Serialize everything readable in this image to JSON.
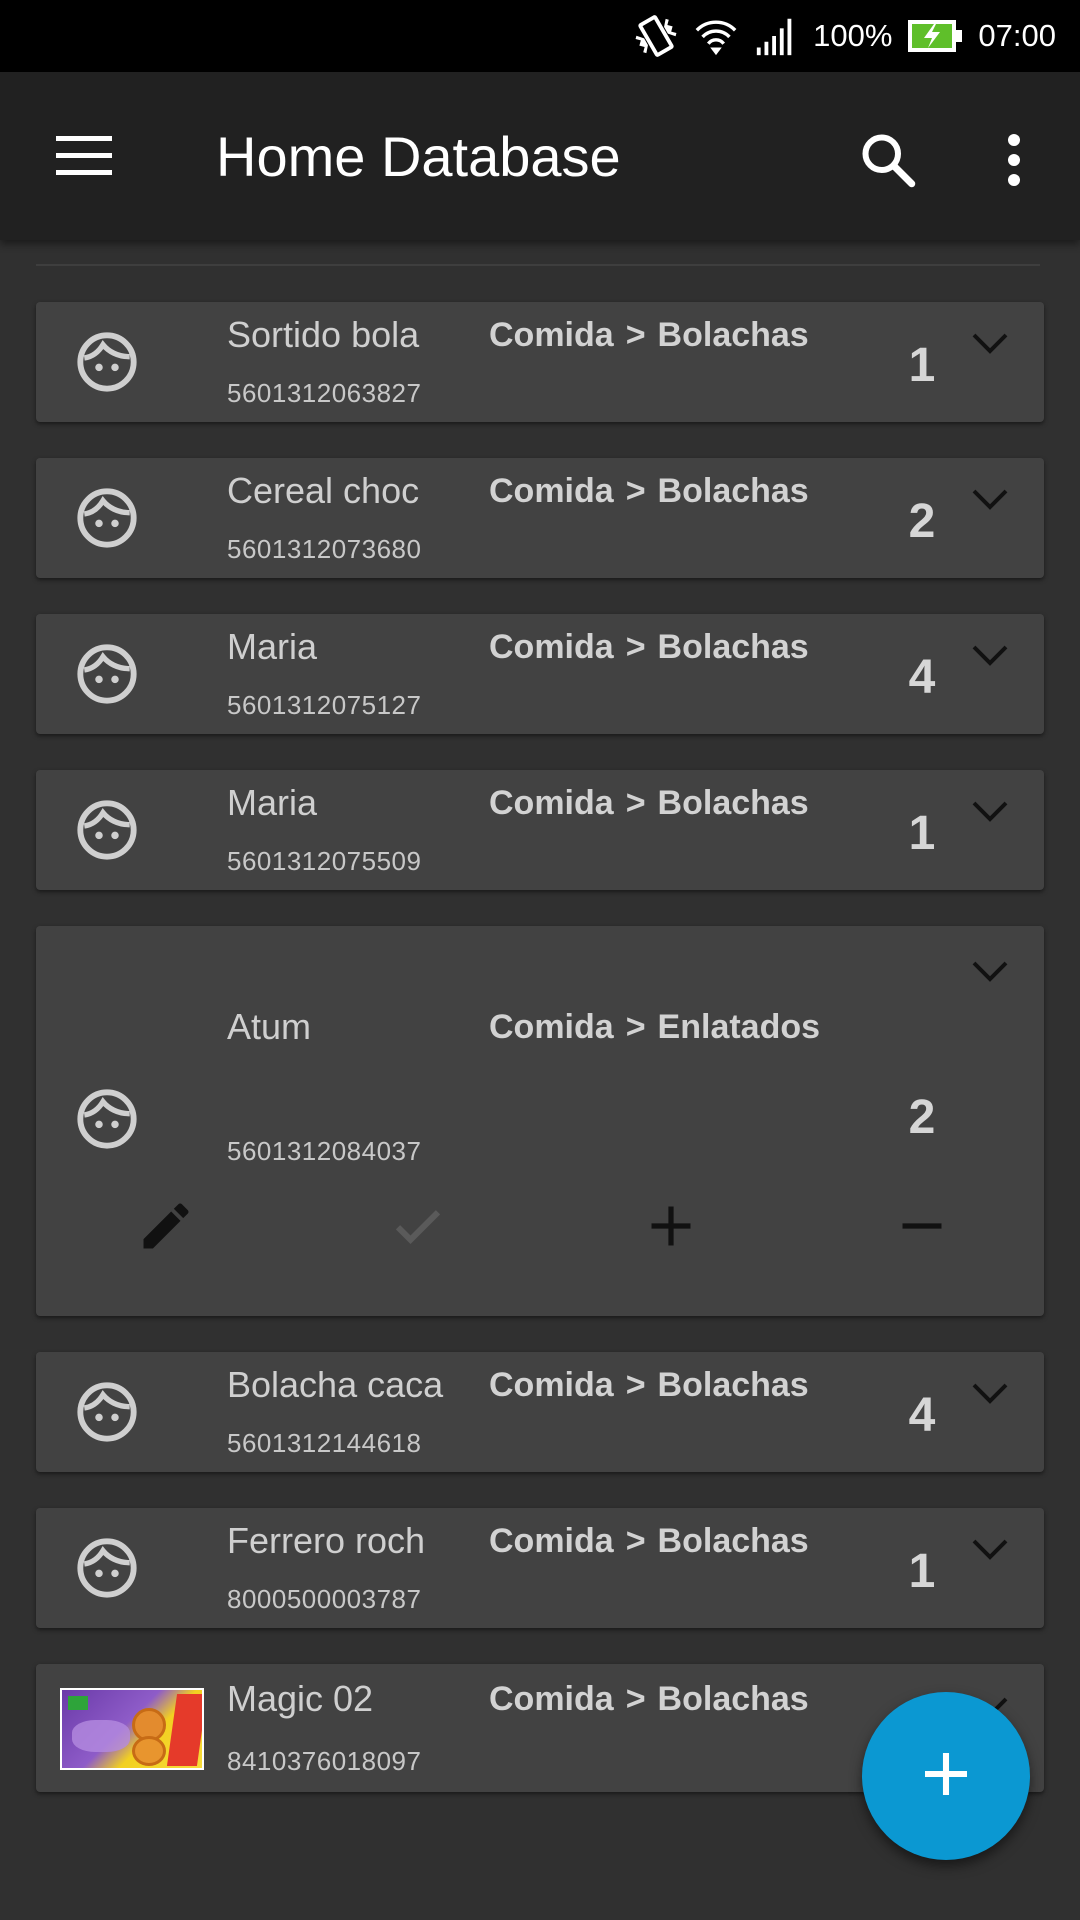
{
  "status_bar": {
    "battery": "100%",
    "time": "07:00",
    "icons": [
      "vibrate-icon",
      "wifi-icon",
      "signal-icon",
      "battery-charging-icon"
    ]
  },
  "app_bar": {
    "title": "Home Database",
    "icons": [
      "menu-icon",
      "search-icon",
      "more-vert-icon"
    ]
  },
  "items": [
    {
      "name": "Sortido bola",
      "barcode": "5601312063827",
      "category": "Comida",
      "subcategory": "Bolachas",
      "quantity": "1",
      "thumbnail": "face-icon",
      "expanded": false
    },
    {
      "name": "Cereal choc",
      "barcode": "5601312073680",
      "category": "Comida",
      "subcategory": "Bolachas",
      "quantity": "2",
      "thumbnail": "face-icon",
      "expanded": false
    },
    {
      "name": "Maria",
      "barcode": "5601312075127",
      "category": "Comida",
      "subcategory": "Bolachas",
      "quantity": "4",
      "thumbnail": "face-icon",
      "expanded": false
    },
    {
      "name": "Maria",
      "barcode": "5601312075509",
      "category": "Comida",
      "subcategory": "Bolachas",
      "quantity": "1",
      "thumbnail": "face-icon",
      "expanded": false
    },
    {
      "name": "Atum",
      "barcode": "5601312084037",
      "category": "Comida",
      "subcategory": "Enlatados",
      "quantity": "2",
      "thumbnail": "face-icon",
      "expanded": true,
      "actions": [
        "edit-icon",
        "check-icon",
        "add-icon",
        "remove-icon"
      ]
    },
    {
      "name": "Bolacha caca",
      "barcode": "5601312144618",
      "category": "Comida",
      "subcategory": "Bolachas",
      "quantity": "4",
      "thumbnail": "face-icon",
      "expanded": false
    },
    {
      "name": "Ferrero roch",
      "barcode": "8000500003787",
      "category": "Comida",
      "subcategory": "Bolachas",
      "quantity": "1",
      "thumbnail": "face-icon",
      "expanded": false
    },
    {
      "name": "Magic 02",
      "barcode": "8410376018097",
      "category": "Comida",
      "subcategory": "Bolachas",
      "quantity": "",
      "thumbnail": "product-photo",
      "expanded": false
    }
  ],
  "category_separator": ">",
  "fab": {
    "icon": "add-icon",
    "color": "#0b98d2"
  },
  "colors": {
    "background": "#303030",
    "app_bar": "#212121",
    "card": "#424242",
    "accent": "#0b98d2"
  }
}
